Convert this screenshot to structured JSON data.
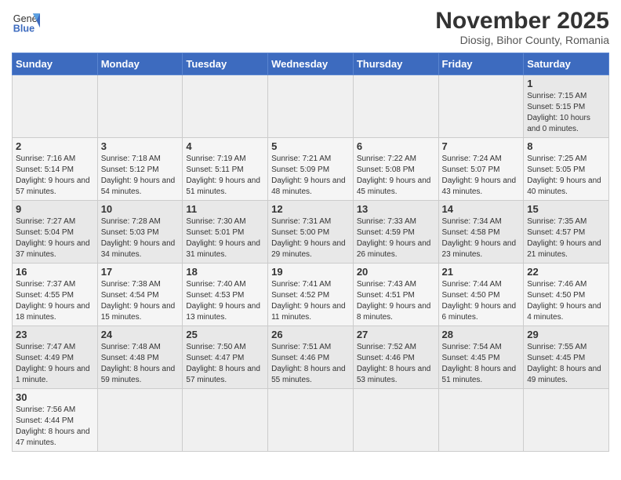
{
  "logo": {
    "text_general": "General",
    "text_blue": "Blue"
  },
  "header": {
    "month": "November 2025",
    "location": "Diosig, Bihor County, Romania"
  },
  "weekdays": [
    "Sunday",
    "Monday",
    "Tuesday",
    "Wednesday",
    "Thursday",
    "Friday",
    "Saturday"
  ],
  "weeks": [
    [
      {
        "day": "",
        "info": ""
      },
      {
        "day": "",
        "info": ""
      },
      {
        "day": "",
        "info": ""
      },
      {
        "day": "",
        "info": ""
      },
      {
        "day": "",
        "info": ""
      },
      {
        "day": "",
        "info": ""
      },
      {
        "day": "1",
        "info": "Sunrise: 7:15 AM\nSunset: 5:15 PM\nDaylight: 10 hours\nand 0 minutes."
      }
    ],
    [
      {
        "day": "2",
        "info": "Sunrise: 7:16 AM\nSunset: 5:14 PM\nDaylight: 9 hours\nand 57 minutes."
      },
      {
        "day": "3",
        "info": "Sunrise: 7:18 AM\nSunset: 5:12 PM\nDaylight: 9 hours\nand 54 minutes."
      },
      {
        "day": "4",
        "info": "Sunrise: 7:19 AM\nSunset: 5:11 PM\nDaylight: 9 hours\nand 51 minutes."
      },
      {
        "day": "5",
        "info": "Sunrise: 7:21 AM\nSunset: 5:09 PM\nDaylight: 9 hours\nand 48 minutes."
      },
      {
        "day": "6",
        "info": "Sunrise: 7:22 AM\nSunset: 5:08 PM\nDaylight: 9 hours\nand 45 minutes."
      },
      {
        "day": "7",
        "info": "Sunrise: 7:24 AM\nSunset: 5:07 PM\nDaylight: 9 hours\nand 43 minutes."
      },
      {
        "day": "8",
        "info": "Sunrise: 7:25 AM\nSunset: 5:05 PM\nDaylight: 9 hours\nand 40 minutes."
      }
    ],
    [
      {
        "day": "9",
        "info": "Sunrise: 7:27 AM\nSunset: 5:04 PM\nDaylight: 9 hours\nand 37 minutes."
      },
      {
        "day": "10",
        "info": "Sunrise: 7:28 AM\nSunset: 5:03 PM\nDaylight: 9 hours\nand 34 minutes."
      },
      {
        "day": "11",
        "info": "Sunrise: 7:30 AM\nSunset: 5:01 PM\nDaylight: 9 hours\nand 31 minutes."
      },
      {
        "day": "12",
        "info": "Sunrise: 7:31 AM\nSunset: 5:00 PM\nDaylight: 9 hours\nand 29 minutes."
      },
      {
        "day": "13",
        "info": "Sunrise: 7:33 AM\nSunset: 4:59 PM\nDaylight: 9 hours\nand 26 minutes."
      },
      {
        "day": "14",
        "info": "Sunrise: 7:34 AM\nSunset: 4:58 PM\nDaylight: 9 hours\nand 23 minutes."
      },
      {
        "day": "15",
        "info": "Sunrise: 7:35 AM\nSunset: 4:57 PM\nDaylight: 9 hours\nand 21 minutes."
      }
    ],
    [
      {
        "day": "16",
        "info": "Sunrise: 7:37 AM\nSunset: 4:55 PM\nDaylight: 9 hours\nand 18 minutes."
      },
      {
        "day": "17",
        "info": "Sunrise: 7:38 AM\nSunset: 4:54 PM\nDaylight: 9 hours\nand 15 minutes."
      },
      {
        "day": "18",
        "info": "Sunrise: 7:40 AM\nSunset: 4:53 PM\nDaylight: 9 hours\nand 13 minutes."
      },
      {
        "day": "19",
        "info": "Sunrise: 7:41 AM\nSunset: 4:52 PM\nDaylight: 9 hours\nand 11 minutes."
      },
      {
        "day": "20",
        "info": "Sunrise: 7:43 AM\nSunset: 4:51 PM\nDaylight: 9 hours\nand 8 minutes."
      },
      {
        "day": "21",
        "info": "Sunrise: 7:44 AM\nSunset: 4:50 PM\nDaylight: 9 hours\nand 6 minutes."
      },
      {
        "day": "22",
        "info": "Sunrise: 7:46 AM\nSunset: 4:50 PM\nDaylight: 9 hours\nand 4 minutes."
      }
    ],
    [
      {
        "day": "23",
        "info": "Sunrise: 7:47 AM\nSunset: 4:49 PM\nDaylight: 9 hours\nand 1 minute."
      },
      {
        "day": "24",
        "info": "Sunrise: 7:48 AM\nSunset: 4:48 PM\nDaylight: 8 hours\nand 59 minutes."
      },
      {
        "day": "25",
        "info": "Sunrise: 7:50 AM\nSunset: 4:47 PM\nDaylight: 8 hours\nand 57 minutes."
      },
      {
        "day": "26",
        "info": "Sunrise: 7:51 AM\nSunset: 4:46 PM\nDaylight: 8 hours\nand 55 minutes."
      },
      {
        "day": "27",
        "info": "Sunrise: 7:52 AM\nSunset: 4:46 PM\nDaylight: 8 hours\nand 53 minutes."
      },
      {
        "day": "28",
        "info": "Sunrise: 7:54 AM\nSunset: 4:45 PM\nDaylight: 8 hours\nand 51 minutes."
      },
      {
        "day": "29",
        "info": "Sunrise: 7:55 AM\nSunset: 4:45 PM\nDaylight: 8 hours\nand 49 minutes."
      }
    ],
    [
      {
        "day": "30",
        "info": "Sunrise: 7:56 AM\nSunset: 4:44 PM\nDaylight: 8 hours\nand 47 minutes."
      },
      {
        "day": "",
        "info": ""
      },
      {
        "day": "",
        "info": ""
      },
      {
        "day": "",
        "info": ""
      },
      {
        "day": "",
        "info": ""
      },
      {
        "day": "",
        "info": ""
      },
      {
        "day": "",
        "info": ""
      }
    ]
  ]
}
